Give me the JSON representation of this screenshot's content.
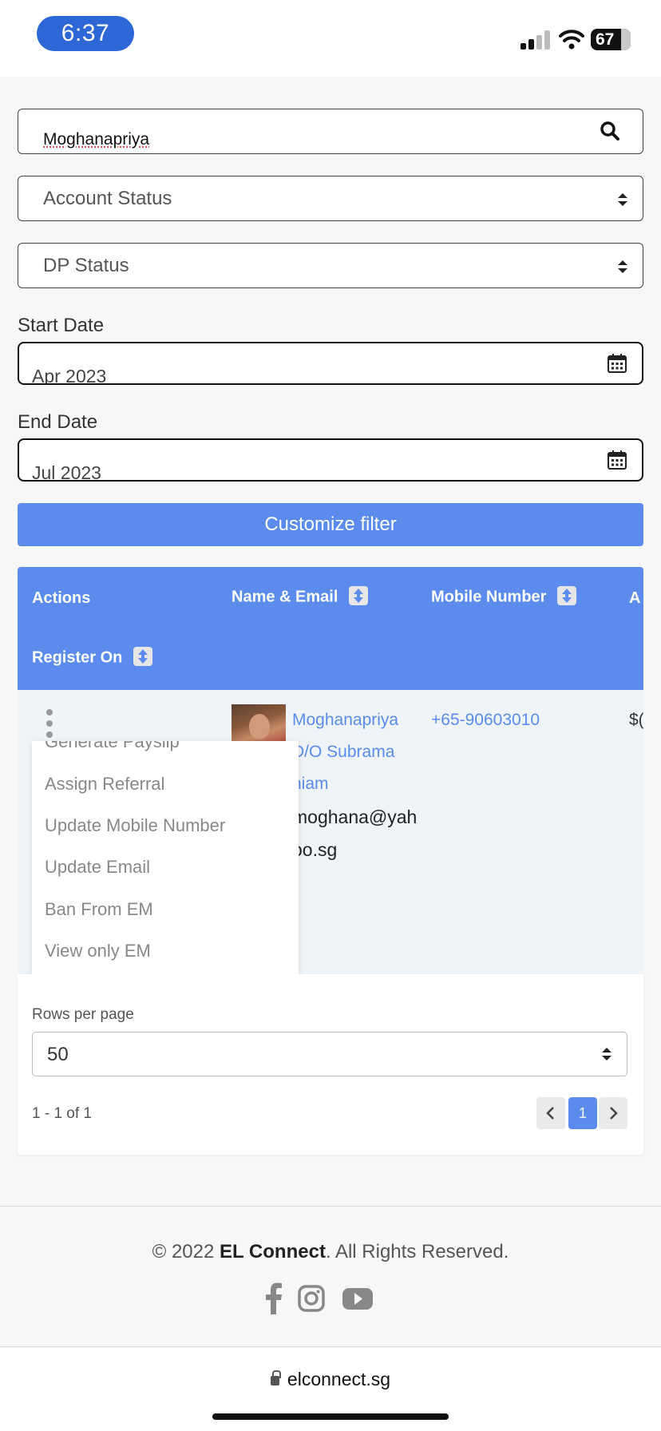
{
  "status_bar": {
    "time": "6:37",
    "battery": "67"
  },
  "search": {
    "value": "Moghanapriya"
  },
  "filters": {
    "account_status": "Account Status",
    "dp_status": "DP Status",
    "start_date_label": "Start Date",
    "start_date_value": "Apr 2023",
    "end_date_label": "End Date",
    "end_date_value": "Jul 2023",
    "customize_button": "Customize filter"
  },
  "table": {
    "headers": {
      "actions": "Actions",
      "name_email": "Name & Email",
      "mobile": "Mobile Number",
      "cut": "A",
      "register_on": "Register On"
    },
    "row": {
      "name_line1": "Moghanapriya",
      "name_line2": "D/O Subrama",
      "name_line3": "niam",
      "email_line1": "moghana@yah",
      "email_line2": "oo.sg",
      "mobile": "+65-90603010",
      "cut_value": "$("
    }
  },
  "action_menu": {
    "items": [
      "Generate Payslip",
      "Assign Referral",
      "Update Mobile Number",
      "Update Email",
      "Ban From EM",
      "View only EM"
    ]
  },
  "pagination": {
    "rows_per_page_label": "Rows per page",
    "rows_per_page_value": "50",
    "range": "1 - 1 of 1",
    "current_page": "1"
  },
  "footer": {
    "copyright_prefix": "© 2022 ",
    "brand": "EL Connect",
    "copyright_suffix": ". All Rights Reserved."
  },
  "browser": {
    "url": "elconnect.sg"
  },
  "colors": {
    "primary": "#5b8ced",
    "time_pill": "#2d67d6"
  },
  "icons": [
    "search-icon",
    "sort-arrows-icon",
    "calendar-icon",
    "kebab-menu-icon",
    "facebook-icon",
    "instagram-icon",
    "youtube-icon",
    "lock-icon"
  ]
}
